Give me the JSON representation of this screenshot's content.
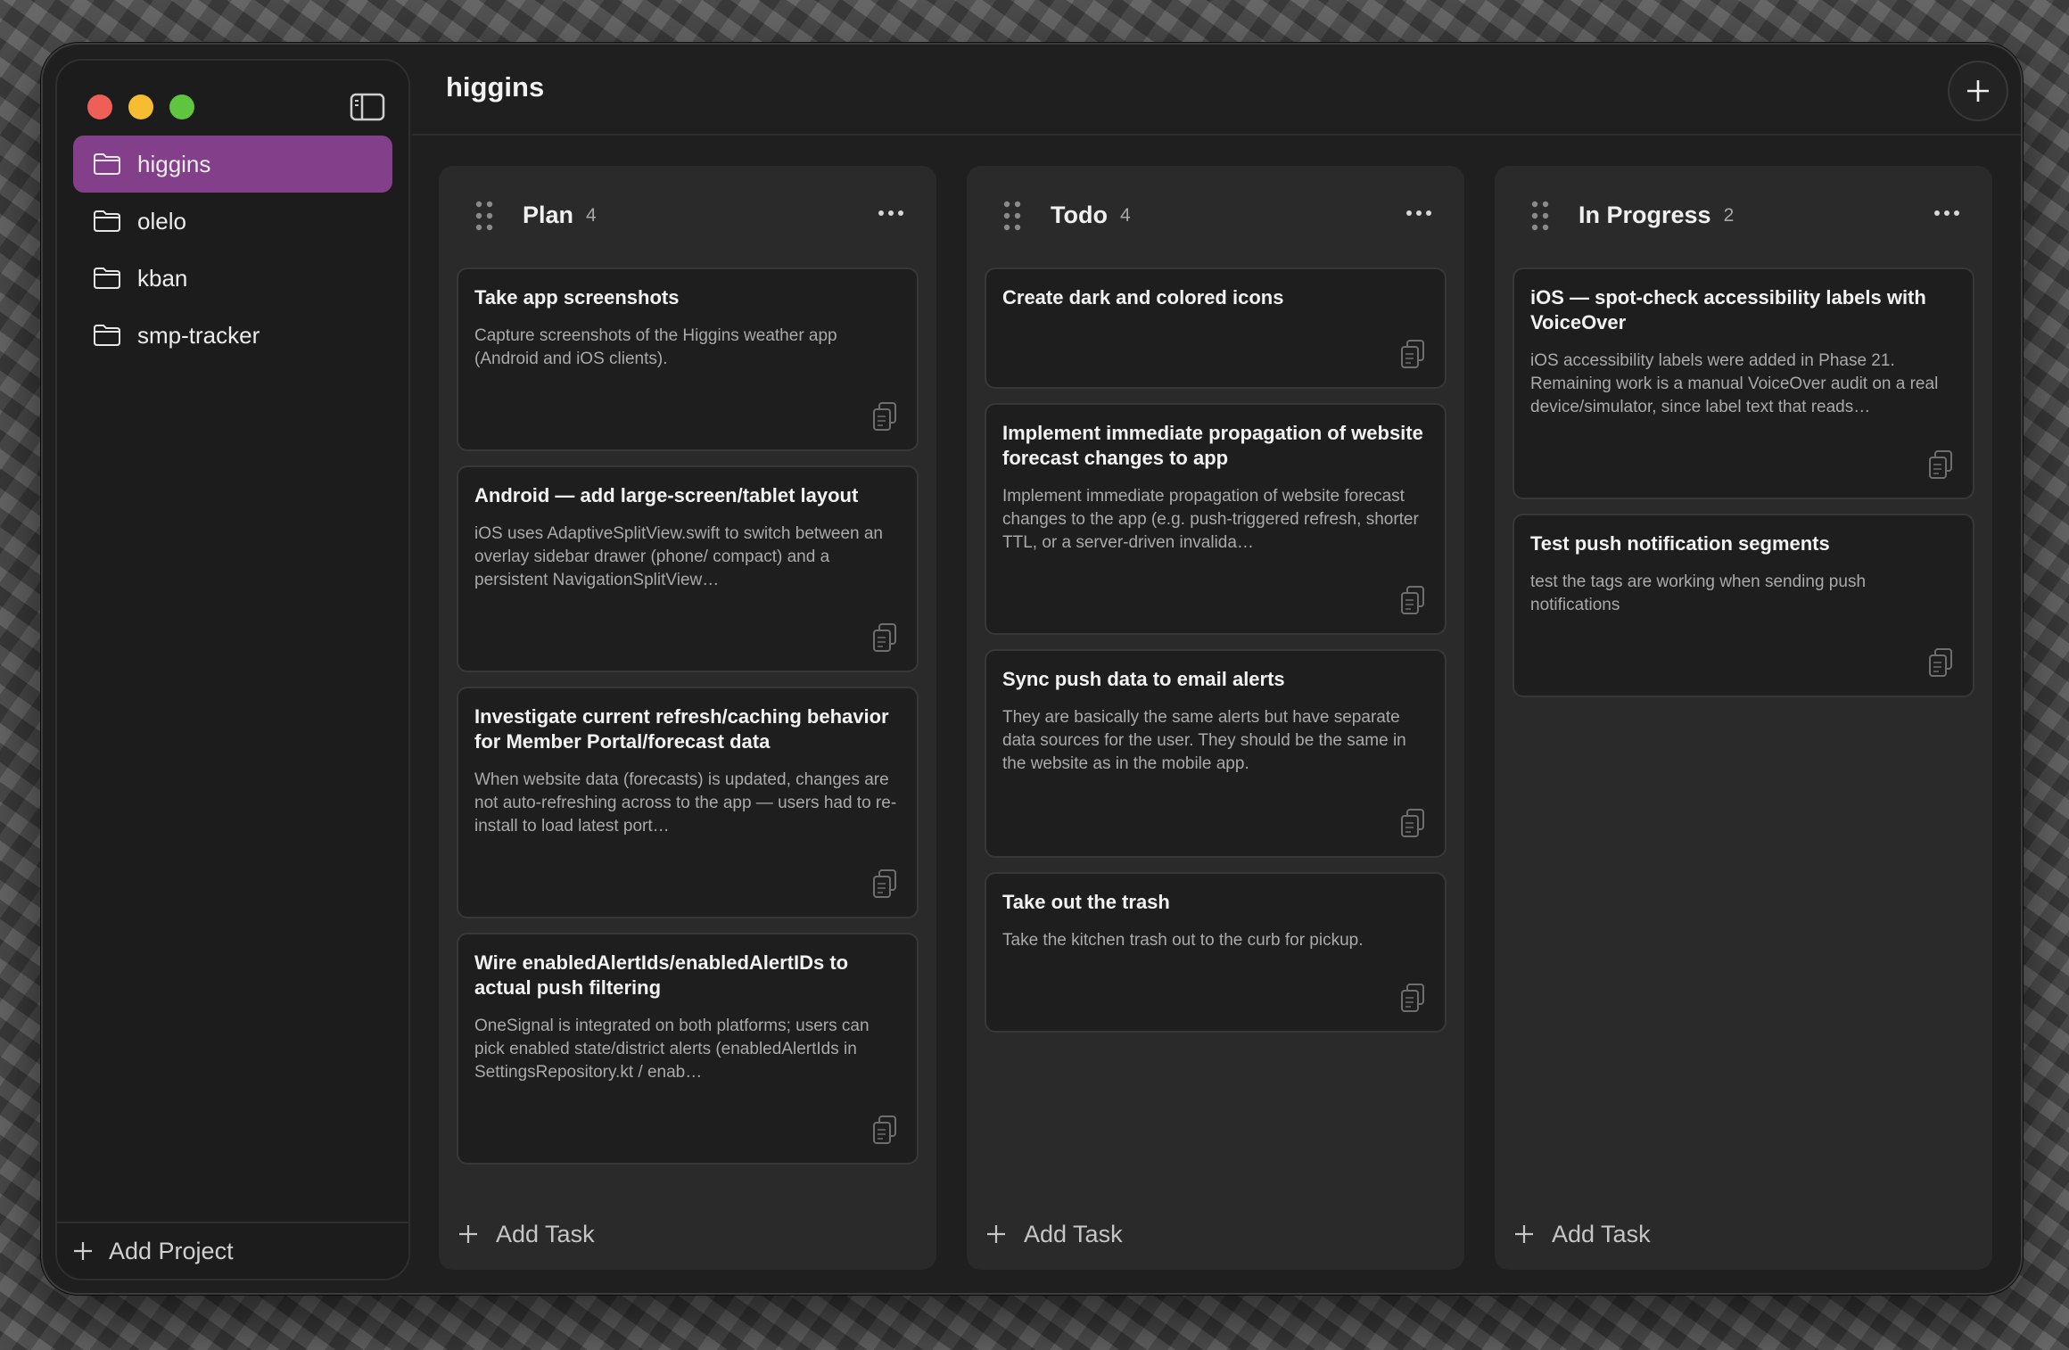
{
  "app": {
    "title": "higgins",
    "add_project_label": "Add Project"
  },
  "sidebar": {
    "projects": [
      {
        "label": "higgins",
        "active": true
      },
      {
        "label": "olelo",
        "active": false
      },
      {
        "label": "kban",
        "active": false
      },
      {
        "label": "smp-tracker",
        "active": false
      }
    ]
  },
  "colors": {
    "accent": "#833f8a",
    "close": "#ee5f57",
    "minimize": "#f5bd2f",
    "zoom": "#5fc53f"
  },
  "board": {
    "add_task_label": "Add Task",
    "columns": [
      {
        "title": "Plan",
        "count": "4",
        "cards": [
          {
            "title": "Take app screenshots",
            "desc": "Capture screenshots of the Higgins weather app (Android and iOS clients)."
          },
          {
            "title": "Android — add large-screen/tablet layout",
            "desc": "iOS uses AdaptiveSplitView.swift to switch between an overlay sidebar drawer (phone/ compact) and a persistent NavigationSplitView…"
          },
          {
            "title": "Investigate current refresh/caching behavior for Member Portal/forecast data",
            "desc": "When website data (forecasts) is updated, changes are not auto-refreshing across to the app — users had to re-install to load latest port…"
          },
          {
            "title": "Wire enabledAlertIds/enabledAlertIDs to actual push filtering",
            "desc": "OneSignal is integrated on both platforms; users can pick enabled state/district alerts (enabledAlertIds in SettingsRepository.kt / enab…"
          }
        ]
      },
      {
        "title": "Todo",
        "count": "4",
        "cards": [
          {
            "title": "Create dark and colored icons",
            "desc": ""
          },
          {
            "title": "Implement immediate propagation of website forecast changes to app",
            "desc": "Implement immediate propagation of website forecast changes to the app (e.g. push-triggered refresh, shorter TTL, or a server-driven invalida…"
          },
          {
            "title": "Sync push data to email alerts",
            "desc": "They are basically the same alerts but have separate data sources for the user. They should be the same in the website as in the mobile app."
          },
          {
            "title": "Take out the trash",
            "desc": "Take the kitchen trash out to the curb for pickup."
          }
        ]
      },
      {
        "title": "In Progress",
        "count": "2",
        "cards": [
          {
            "title": "iOS — spot-check accessibility labels with VoiceOver",
            "desc": "iOS accessibility labels were added in Phase 21. Remaining work is a manual VoiceOver audit on a real device/simulator, since label text that reads…"
          },
          {
            "title": "Test push notification segments",
            "desc": "test the tags are working when sending push notifications"
          }
        ]
      }
    ]
  }
}
